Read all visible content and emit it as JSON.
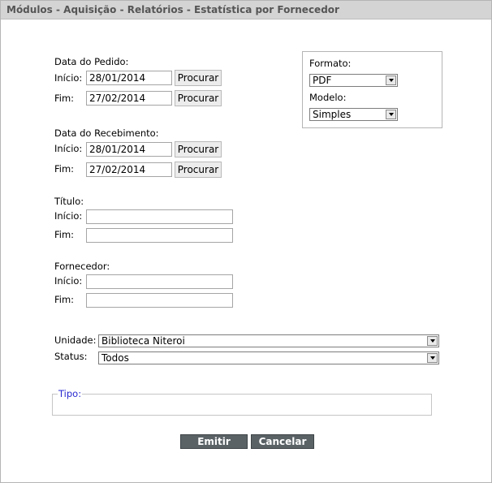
{
  "title": "Módulos - Aquisição - Relatórios - Estatística por Fornecedor",
  "data_pedido": {
    "heading": "Data do Pedido:",
    "inicio_label": "Início:",
    "inicio_value": "28/01/2014",
    "fim_label": "Fim:",
    "fim_value": "27/02/2014",
    "button": "Procurar"
  },
  "data_recebimento": {
    "heading": "Data do Recebimento:",
    "inicio_label": "Início:",
    "inicio_value": "28/01/2014",
    "fim_label": "Fim:",
    "fim_value": "27/02/2014",
    "button": "Procurar"
  },
  "titulo": {
    "heading": "Título:",
    "inicio_label": "Início:",
    "inicio_value": "",
    "fim_label": "Fim:",
    "fim_value": ""
  },
  "fornecedor": {
    "heading": "Fornecedor:",
    "inicio_label": "Início:",
    "inicio_value": "",
    "fim_label": "Fim:",
    "fim_value": ""
  },
  "formato": {
    "label": "Formato:",
    "value": "PDF"
  },
  "modelo": {
    "label": "Modelo:",
    "value": "Simples"
  },
  "unidade": {
    "label": "Unidade:",
    "value": "Biblioteca Niteroi"
  },
  "status": {
    "label": "Status:",
    "value": "Todos"
  },
  "tipo": {
    "legend": "Tipo:"
  },
  "actions": {
    "emitir": "Emitir",
    "cancelar": "Cancelar"
  },
  "colors": {
    "titlebar_bg": "#d4d4d4",
    "title_text": "#555555",
    "action_button": "#5a6266",
    "legend_text": "#2a2ad0"
  }
}
